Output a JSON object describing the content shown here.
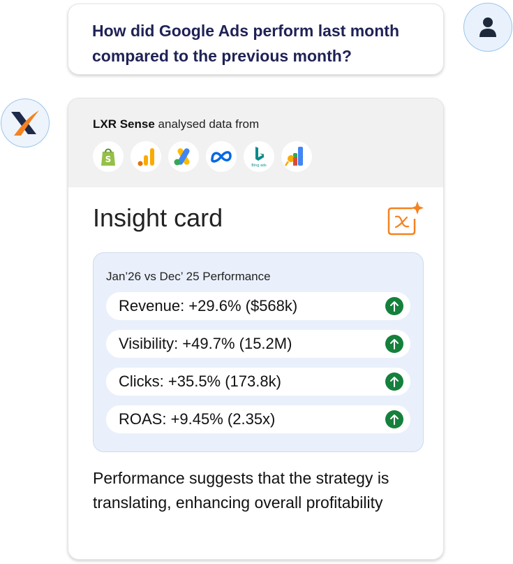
{
  "user_message": {
    "line1": "How did Google Ads perform last month",
    "line2": "compared to the previous month?"
  },
  "icons": {
    "user_avatar": "user-icon",
    "bot_avatar": "lxr-x-logo-icon",
    "insight": "sparkle-x-icon",
    "metric_trend": "arrow-up-icon"
  },
  "response": {
    "brand": "LXR Sense",
    "analysed_text": "analysed data from",
    "sources": [
      "shopify-icon",
      "google-analytics-icon",
      "google-ads-icon",
      "meta-icon",
      "bing-ads-icon",
      "looker-studio-icon"
    ],
    "bing_caption": "Bing ads",
    "insight_title": "Insight card",
    "performance": {
      "title": "Jan’26 vs Dec’ 25 Performance",
      "metrics": [
        {
          "label": "Revenue: +29.6% ($568k)"
        },
        {
          "label": "Visibility: +49.7% (15.2M)"
        },
        {
          "label": "Clicks: +35.5% (173.8k)"
        },
        {
          "label": "ROAS: +9.45% (2.35x)"
        }
      ]
    },
    "summary": "Performance suggests that the strategy is translating, enhancing overall profitability"
  },
  "colors": {
    "question_text": "#1f2255",
    "accent_orange": "#f58220",
    "trend_up": "#14803c",
    "perf_bg": "#e9f0fc",
    "header_bg": "#f1f1f1"
  }
}
